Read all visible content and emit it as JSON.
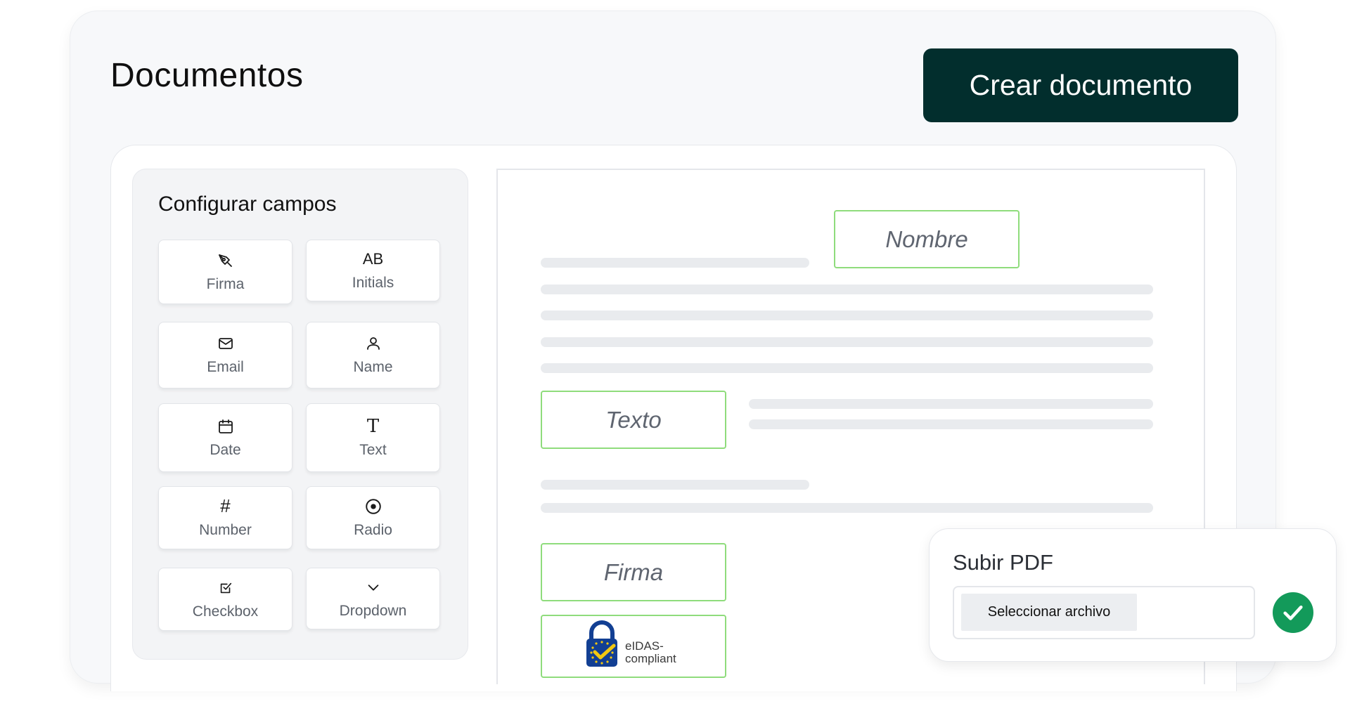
{
  "header": {
    "title": "Documentos",
    "create_label": "Crear documento"
  },
  "fields_panel": {
    "title": "Configurar campos",
    "items": [
      {
        "label": "Firma",
        "icon": "pen-nib-icon"
      },
      {
        "label": "Initials",
        "icon": "ab-text-icon",
        "glyph": "AB"
      },
      {
        "label": "Email",
        "icon": "envelope-icon"
      },
      {
        "label": "Name",
        "icon": "user-icon"
      },
      {
        "label": "Date",
        "icon": "calendar-icon"
      },
      {
        "label": "Text",
        "icon": "text-t-icon",
        "glyph": "T"
      },
      {
        "label": "Number",
        "icon": "hash-icon",
        "glyph": "#"
      },
      {
        "label": "Radio",
        "icon": "radio-icon"
      },
      {
        "label": "Checkbox",
        "icon": "checkbox-icon"
      },
      {
        "label": "Dropdown",
        "icon": "chevron-down-icon"
      }
    ]
  },
  "document": {
    "fields": {
      "nombre": "Nombre",
      "texto": "Texto",
      "firma": "Firma"
    },
    "badge": {
      "line1": "eIDAS-",
      "line2": "compliant",
      "icon": "padlock-check-icon"
    }
  },
  "upload": {
    "title": "Subir PDF",
    "button_label": "Seleccionar archivo",
    "status_icon": "check-circle-icon"
  },
  "colors": {
    "primary": "#022e2d",
    "field_border": "#8fdc7c",
    "success": "#139a5a",
    "eu_blue": "#123f93",
    "eu_gold": "#f2c811"
  }
}
